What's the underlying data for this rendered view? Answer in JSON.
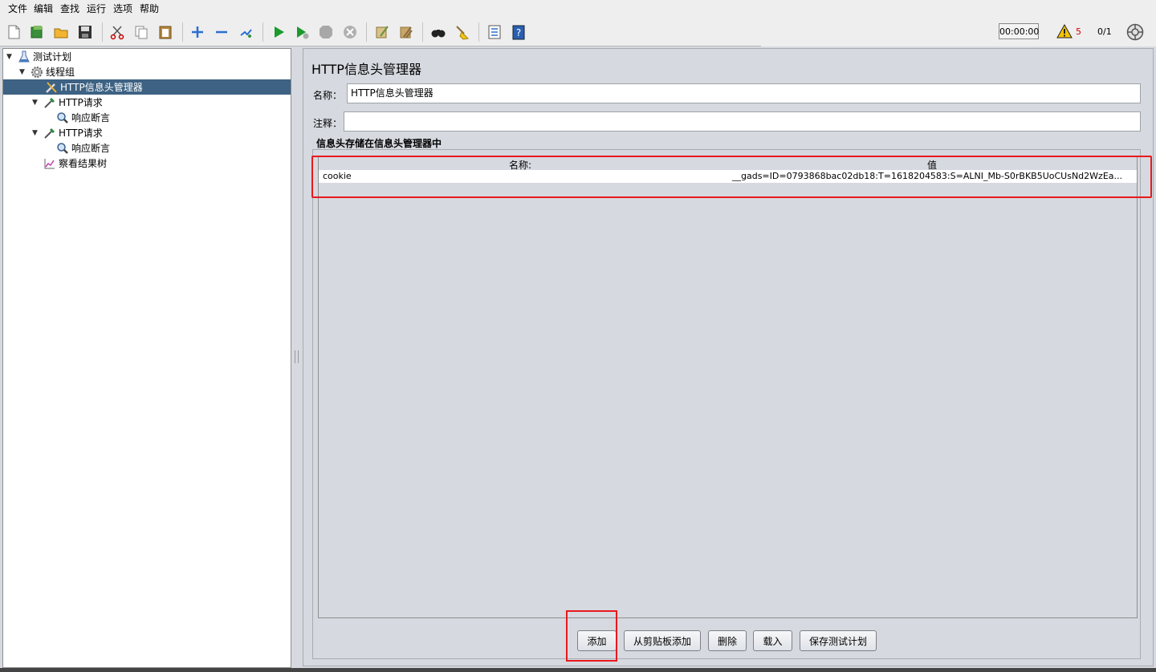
{
  "menu": [
    "文件",
    "编辑",
    "查找",
    "运行",
    "选项",
    "帮助"
  ],
  "toolbar": {
    "icons": [
      "new-icon",
      "templates-icon",
      "open-icon",
      "save-icon",
      "cut-icon",
      "copy-icon",
      "paste-icon",
      "expand-icon",
      "collapse-icon",
      "toggle-icon",
      "start-icon",
      "start-no-pauses-icon",
      "stop-icon",
      "shutdown-icon",
      "clear-icon",
      "clear-all-icon",
      "search-icon",
      "reset-search-icon",
      "function-helper-icon",
      "help-icon"
    ],
    "timer": "00:00:00",
    "warning_count": "5",
    "threads": "0/1"
  },
  "tree": [
    {
      "label": "测试计划",
      "icon": "flask-icon"
    },
    {
      "label": "线程组",
      "icon": "gear-icon"
    },
    {
      "label": "HTTP信息头管理器",
      "icon": "wrench-icon"
    },
    {
      "label": "HTTP请求",
      "icon": "pipette-icon"
    },
    {
      "label": "响应断言",
      "icon": "magnifier-icon"
    },
    {
      "label": "HTTP请求",
      "icon": "pipette-icon"
    },
    {
      "label": "响应断言",
      "icon": "magnifier-icon"
    },
    {
      "label": "察看结果树",
      "icon": "graph-icon"
    }
  ],
  "panel": {
    "title": "HTTP信息头管理器",
    "name_label": "名称：",
    "name_value": "HTTP信息头管理器",
    "comment_label": "注释：",
    "comment_value": "",
    "section_title": "信息头存储在信息头管理器中",
    "columns": [
      "名称:",
      "值"
    ],
    "rows": [
      {
        "name": "cookie",
        "value": "__gads=ID=0793868bac02db18:T=1618204583:S=ALNI_Mb-S0rBKB5UoCUsNd2WzEa..."
      }
    ]
  },
  "buttons": [
    "添加",
    "从剪贴板添加",
    "删除",
    "载入",
    "保存测试计划"
  ],
  "colors": {
    "highlight": "#e8191e",
    "selection": "#3d6283",
    "warning": "#d40000"
  }
}
